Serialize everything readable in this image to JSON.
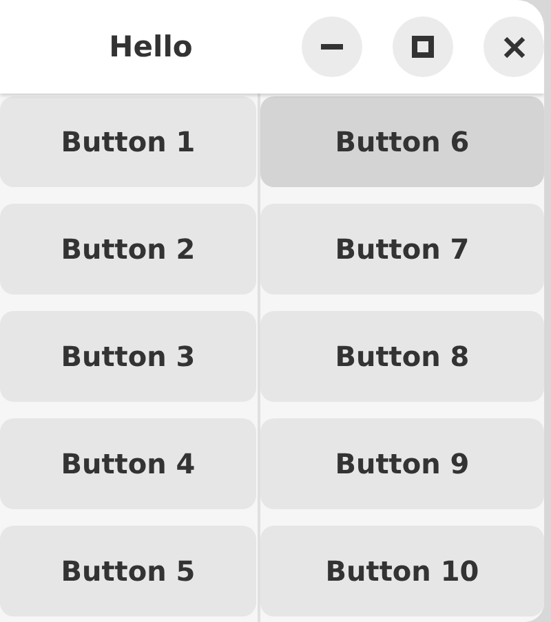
{
  "window": {
    "title": "Hello",
    "controls": [
      {
        "kind": "minimize"
      },
      {
        "kind": "maximize"
      },
      {
        "kind": "close"
      }
    ]
  },
  "columns": [
    {
      "buttons": [
        {
          "label": "Button 1",
          "hovered": false
        },
        {
          "label": "Button 2",
          "hovered": false
        },
        {
          "label": "Button 3",
          "hovered": false
        },
        {
          "label": "Button 4",
          "hovered": false
        },
        {
          "label": "Button 5",
          "hovered": false
        }
      ]
    },
    {
      "buttons": [
        {
          "label": "Button 6",
          "hovered": true
        },
        {
          "label": "Button 7",
          "hovered": false
        },
        {
          "label": "Button 8",
          "hovered": false
        },
        {
          "label": "Button 9",
          "hovered": false
        },
        {
          "label": "Button 10",
          "hovered": false
        }
      ]
    }
  ]
}
